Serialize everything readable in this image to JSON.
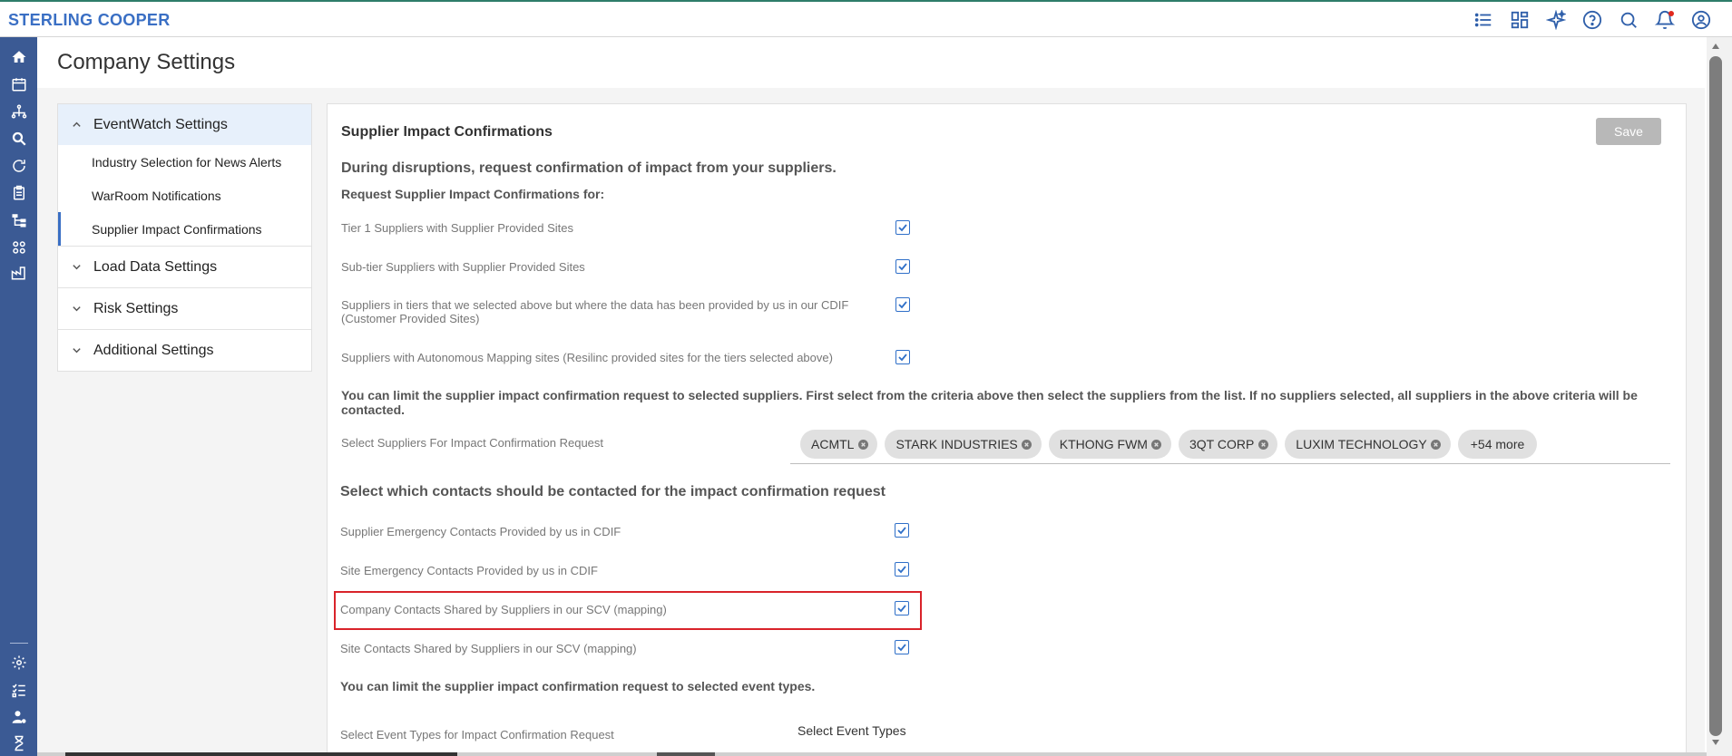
{
  "app": {
    "logo": "STERLING COOPER"
  },
  "topbar": {
    "icons": [
      "list-icon",
      "dashboard-icon",
      "sparkle-icon",
      "help-icon",
      "search-icon",
      "bell-icon",
      "user-icon"
    ]
  },
  "rail": {
    "icons": [
      "home-icon",
      "calendar-icon",
      "network-icon",
      "search-zoom-icon",
      "refresh-icon",
      "clipboard-icon",
      "hierarchy-icon",
      "apps-icon",
      "factory-icon",
      "settings-icon",
      "checklist-icon",
      "user-settings-icon",
      "hourglass-icon",
      "building-icon"
    ]
  },
  "page": {
    "title": "Company Settings"
  },
  "nav": {
    "groups": [
      {
        "label": "EventWatch Settings",
        "expanded": true,
        "items": [
          "Industry Selection for News Alerts",
          "WarRoom Notifications",
          "Supplier Impact Confirmations"
        ]
      },
      {
        "label": "Load Data Settings",
        "expanded": false
      },
      {
        "label": "Risk Settings",
        "expanded": false
      },
      {
        "label": "Additional Settings",
        "expanded": false
      }
    ]
  },
  "panel": {
    "title": "Supplier Impact Confirmations",
    "save_label": "Save",
    "heading1": "During disruptions, request confirmation of impact from your suppliers.",
    "subheading1": "Request Supplier Impact Confirmations for:",
    "rows1": [
      {
        "label": "Tier 1 Suppliers with Supplier Provided Sites",
        "checked": true
      },
      {
        "label": "Sub-tier Suppliers with Supplier Provided Sites",
        "checked": true
      },
      {
        "label": "Suppliers in tiers that we selected above but where the data has been provided by us in our CDIF (Customer Provided Sites)",
        "checked": true
      },
      {
        "label": "Suppliers with Autonomous Mapping sites (Resilinc provided sites for the tiers selected above)",
        "checked": true
      }
    ],
    "limit_note": "You can limit the supplier impact confirmation request to selected suppliers. First select from the criteria above then select the suppliers from the list. If no suppliers selected, all suppliers in the above criteria will be contacted.",
    "supplier_select_label": "Select Suppliers For Impact Confirmation Request",
    "chips": [
      "ACMTL",
      "STARK INDUSTRIES",
      "KTHONG FWM",
      "3QT CORP",
      "LUXIM TECHNOLOGY"
    ],
    "more_chip": "+54 more",
    "heading2": "Select which contacts should be contacted for the impact confirmation request",
    "rows2": [
      {
        "label": "Supplier Emergency Contacts Provided by us in CDIF",
        "checked": true
      },
      {
        "label": "Site Emergency Contacts Provided by us in CDIF",
        "checked": true
      },
      {
        "label": "Company Contacts Shared by Suppliers in our SCV (mapping)",
        "checked": true
      },
      {
        "label": "Site Contacts Shared by Suppliers in our SCV (mapping)",
        "checked": true
      }
    ],
    "event_note": "You can limit the supplier impact confirmation request to selected event types.",
    "event_label": "Select Event Types for Impact Confirmation Request",
    "event_select": "Select Event Types"
  }
}
